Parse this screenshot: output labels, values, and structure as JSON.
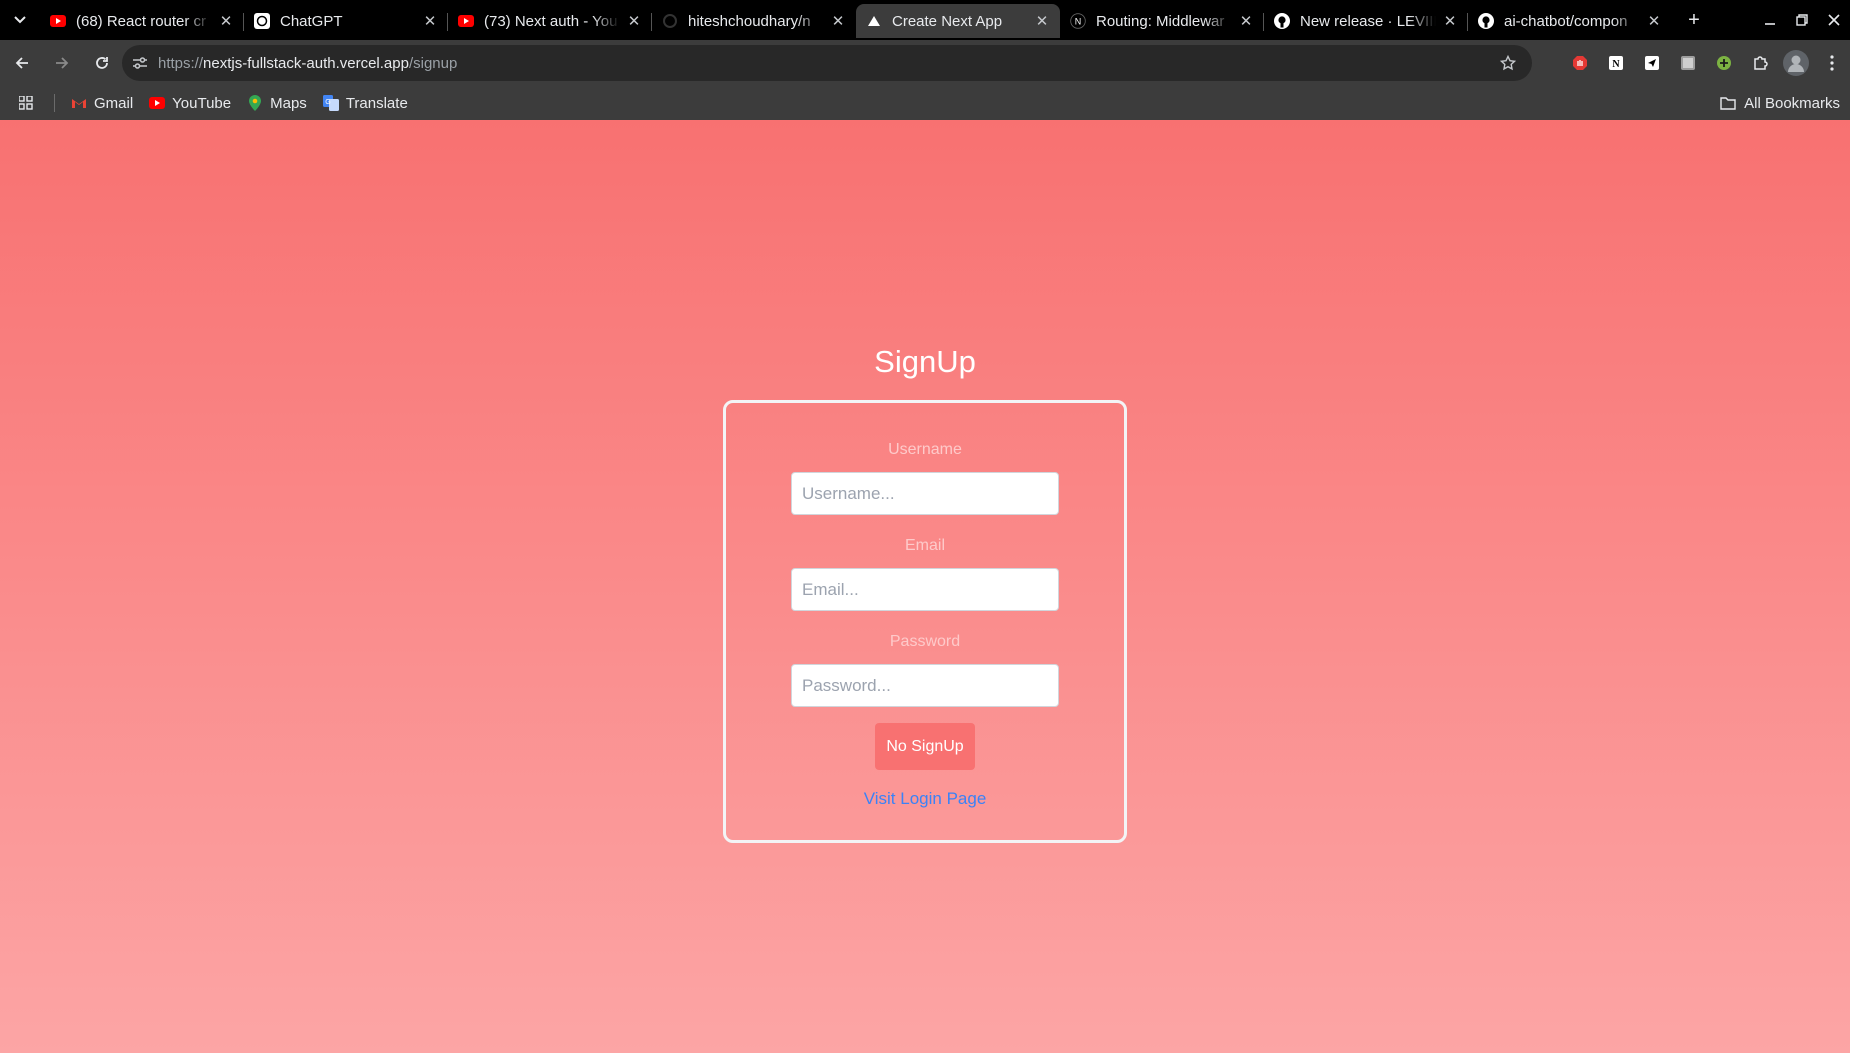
{
  "browser": {
    "tabs": [
      {
        "title": "(68) React router cr",
        "favicon": "youtube-icon",
        "active": false
      },
      {
        "title": "ChatGPT",
        "favicon": "chatgpt-icon",
        "active": false
      },
      {
        "title": "(73) Next auth - You",
        "favicon": "youtube-icon",
        "active": false
      },
      {
        "title": "hiteshchoudhary/n",
        "favicon": "github-icon",
        "active": false
      },
      {
        "title": "Create Next App",
        "favicon": "vercel-icon",
        "active": true
      },
      {
        "title": "Routing: Middlewar",
        "favicon": "nextjs-icon",
        "active": false
      },
      {
        "title": "New release · LEVIII",
        "favicon": "github-icon",
        "active": false
      },
      {
        "title": "ai-chatbot/compon",
        "favicon": "github-icon",
        "active": false
      }
    ],
    "url": {
      "scheme": "https://",
      "host": "nextjs-fullstack-auth.vercel.app",
      "path": "/signup"
    },
    "bookmarks": [
      {
        "label": "Gmail",
        "icon": "gmail-icon"
      },
      {
        "label": "YouTube",
        "icon": "youtube-icon"
      },
      {
        "label": "Maps",
        "icon": "maps-icon"
      },
      {
        "label": "Translate",
        "icon": "translate-icon"
      }
    ],
    "all_bookmarks_label": "All Bookmarks"
  },
  "page": {
    "heading": "SignUp",
    "form": {
      "username_label": "Username",
      "username_placeholder": "Username...",
      "username_value": "",
      "email_label": "Email",
      "email_placeholder": "Email...",
      "email_value": "",
      "password_label": "Password",
      "password_placeholder": "Password...",
      "password_value": "",
      "submit_label": "No SignUp",
      "login_link": "Visit Login Page"
    }
  },
  "colors": {
    "gradient_top": "#f87171",
    "gradient_bottom": "#fca5a5",
    "button_bg": "#f87171",
    "link": "#3b82f6",
    "label": "#fecaca"
  }
}
